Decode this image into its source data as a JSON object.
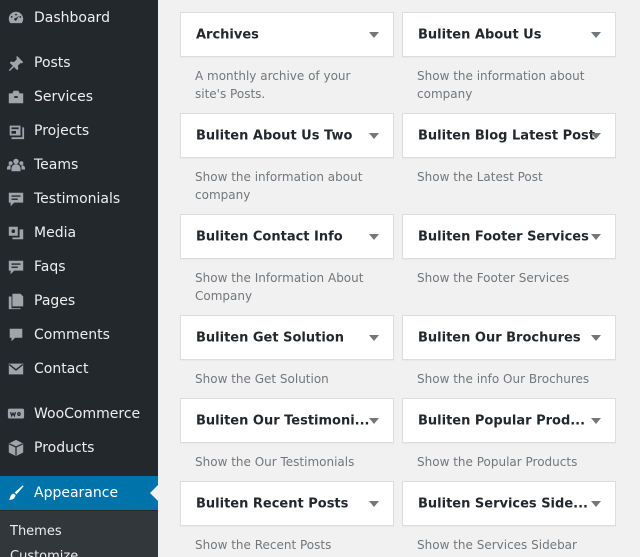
{
  "sidebar": {
    "items": [
      {
        "key": "dashboard",
        "label": "Dashboard",
        "icon": "dashboard-icon"
      },
      {
        "key": "posts",
        "label": "Posts",
        "icon": "pin-icon"
      },
      {
        "key": "services",
        "label": "Services",
        "icon": "briefcase-icon"
      },
      {
        "key": "projects",
        "label": "Projects",
        "icon": "portfolio-icon"
      },
      {
        "key": "teams",
        "label": "Teams",
        "icon": "groups-icon"
      },
      {
        "key": "testimonials",
        "label": "Testimonials",
        "icon": "chat-icon"
      },
      {
        "key": "media",
        "label": "Media",
        "icon": "media-icon"
      },
      {
        "key": "faqs",
        "label": "Faqs",
        "icon": "chat-icon"
      },
      {
        "key": "pages",
        "label": "Pages",
        "icon": "pages-icon"
      },
      {
        "key": "comments",
        "label": "Comments",
        "icon": "comment-icon"
      },
      {
        "key": "contact",
        "label": "Contact",
        "icon": "envelope-icon"
      },
      {
        "key": "woocommerce",
        "label": "WooCommerce",
        "icon": "woo-icon"
      },
      {
        "key": "products",
        "label": "Products",
        "icon": "product-box-icon"
      },
      {
        "key": "appearance",
        "label": "Appearance",
        "icon": "paintbrush-icon",
        "active": true
      }
    ],
    "submenu": [
      {
        "label": "Themes"
      },
      {
        "label": "Customize"
      }
    ]
  },
  "widgets": [
    {
      "title": "Archives",
      "description": "A monthly archive of your site's Posts."
    },
    {
      "title": "Buliten About Us",
      "description": "Show the information about company"
    },
    {
      "title": "Buliten About Us Two",
      "description": "Show the information about company"
    },
    {
      "title": "Buliten Blog Latest Post",
      "description": "Show the Latest Post"
    },
    {
      "title": "Buliten Contact Info",
      "description": "Show the Information About Company"
    },
    {
      "title": "Buliten Footer Services",
      "description": "Show the Footer Services"
    },
    {
      "title": "Buliten Get Solution",
      "description": "Show the Get Solution"
    },
    {
      "title": "Buliten Our Brochures",
      "description": "Show the info Our Brochures"
    },
    {
      "title": "Buliten Our Testimoni...",
      "description": "Show the Our Testimonials"
    },
    {
      "title": "Buliten Popular Prod...",
      "description": "Show the Popular Products"
    },
    {
      "title": "Buliten Recent Posts",
      "description": "Show the Recent Posts"
    },
    {
      "title": "Buliten Services Side...",
      "description": "Show the Services Sidebar"
    }
  ],
  "colors": {
    "sidebar_bg": "#23282d",
    "active_bg": "#0073aa",
    "submenu_bg": "#32373c",
    "content_bg": "#f1f1f1"
  }
}
